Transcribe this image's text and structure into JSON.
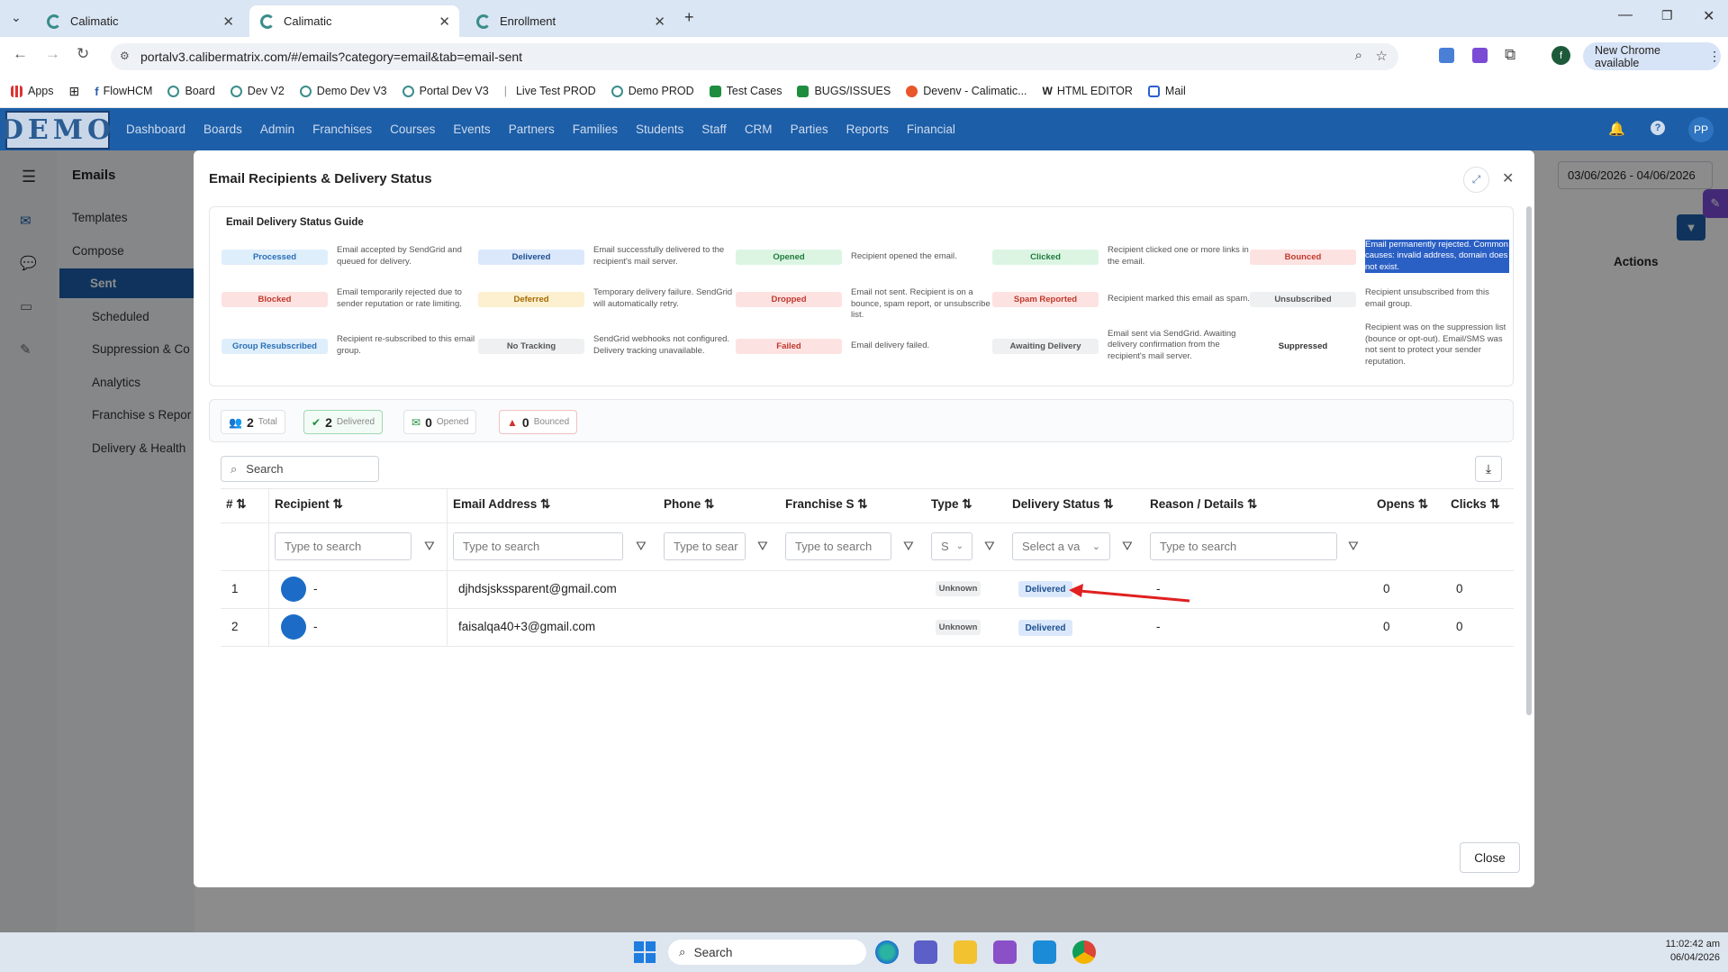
{
  "browser": {
    "tabs": [
      {
        "title": "Calimatic"
      },
      {
        "title": "Calimatic"
      },
      {
        "title": "Enrollment"
      }
    ],
    "url": "portalv3.calibermatrix.com/#/emails?category=email&tab=email-sent",
    "profile_initial": "f",
    "update_label": "New Chrome available",
    "bookmarks": [
      "Apps",
      "FlowHCM",
      "Board",
      "Dev V2",
      "Demo Dev V3",
      "Portal Dev V3",
      "Live Test PROD",
      "Demo PROD",
      "Test Cases",
      "BUGS/ISSUES",
      "Devenv - Calimatic...",
      "HTML EDITOR",
      "Mail"
    ]
  },
  "app": {
    "logo": "DEMO",
    "nav": [
      "Dashboard",
      "Boards",
      "Admin",
      "Franchises",
      "Courses",
      "Events",
      "Partners",
      "Families",
      "Students",
      "Staff",
      "CRM",
      "Parties",
      "Reports",
      "Financial"
    ],
    "user_initials": "PP",
    "section_title": "Emails",
    "sidebar": [
      "Templates",
      "Compose",
      "Sent",
      "Scheduled",
      "Suppression & Co",
      "Analytics",
      "Franchise s Repor",
      "Delivery & Health"
    ],
    "date_range": "03/06/2026 - 04/06/2026",
    "bg_actions_header": "Actions"
  },
  "modal": {
    "title": "Email Recipients & Delivery Status",
    "guide_title": "Email Delivery Status Guide",
    "guide": [
      {
        "status": "Processed",
        "desc": "Email accepted by SendGrid and queued for delivery.",
        "bg": "#dfeefb",
        "fg": "#2a6fb5"
      },
      {
        "status": "Delivered",
        "desc": "Email successfully delivered to the recipient's mail server.",
        "bg": "#dbe8fb",
        "fg": "#1d4f91"
      },
      {
        "status": "Opened",
        "desc": "Recipient opened the email.",
        "bg": "#dcf5e3",
        "fg": "#1e7a3c"
      },
      {
        "status": "Clicked",
        "desc": "Recipient clicked one or more links in the email.",
        "bg": "#dcf5e3",
        "fg": "#1e7a3c"
      },
      {
        "status": "Bounced",
        "desc": "Email permanently rejected. Common causes: invalid address, domain does not exist.",
        "bg": "#fde2e2",
        "fg": "#c0392b"
      },
      {
        "status": "Blocked",
        "desc": "Email temporarily rejected due to sender reputation or rate limiting.",
        "bg": "#fde2e2",
        "fg": "#c0392b"
      },
      {
        "status": "Deferred",
        "desc": "Temporary delivery failure. SendGrid will automatically retry.",
        "bg": "#fdf0d0",
        "fg": "#a66a00"
      },
      {
        "status": "Dropped",
        "desc": "Email not sent. Recipient is on a bounce, spam report, or unsubscribe list.",
        "bg": "#fde2e2",
        "fg": "#c0392b"
      },
      {
        "status": "Spam Reported",
        "desc": "Recipient marked this email as spam.",
        "bg": "#fde2e2",
        "fg": "#c0392b"
      },
      {
        "status": "Unsubscribed",
        "desc": "Recipient unsubscribed from this email group.",
        "bg": "#eef0f2",
        "fg": "#555555"
      },
      {
        "status": "Group Resubscribed",
        "desc": "Recipient re-subscribed to this email group.",
        "bg": "#dfeefb",
        "fg": "#2a6fb5"
      },
      {
        "status": "No Tracking",
        "desc": "SendGrid webhooks not configured. Delivery tracking unavailable.",
        "bg": "#eef0f2",
        "fg": "#555555"
      },
      {
        "status": "Failed",
        "desc": "Email delivery failed.",
        "bg": "#fde2e2",
        "fg": "#c0392b"
      },
      {
        "status": "Awaiting Delivery",
        "desc": "Email sent via SendGrid. Awaiting delivery confirmation from the recipient's mail server.",
        "bg": "#eef0f2",
        "fg": "#555555"
      },
      {
        "status": "Suppressed",
        "desc": "Recipient was on the suppression list (bounce or opt-out). Email/SMS was not sent to protect your sender reputation.",
        "bg": "#ffffff",
        "fg": "#333333"
      }
    ],
    "stats": [
      {
        "count": "2",
        "label": "Total"
      },
      {
        "count": "2",
        "label": "Delivered"
      },
      {
        "count": "0",
        "label": "Opened"
      },
      {
        "count": "0",
        "label": "Bounced"
      }
    ],
    "search_placeholder": "Search",
    "columns": [
      "#",
      "Recipient",
      "Email Address",
      "Phone",
      "Franchise S",
      "Type",
      "Delivery Status",
      "Reason / Details",
      "Opens",
      "Clicks"
    ],
    "filters": {
      "recipient": "Type to search",
      "email": "Type to search",
      "phone": "Type to sear",
      "franchise": "Type to search",
      "type": "S",
      "status": "Select a va",
      "reason": "Type to search"
    },
    "rows": [
      {
        "num": "1",
        "recipient": "-",
        "email": "djhdsjskssparent@gmail.com",
        "phone": "",
        "type": "Unknown",
        "status": "Delivered",
        "reason": "-",
        "opens": "0",
        "clicks": "0"
      },
      {
        "num": "2",
        "recipient": "-",
        "email": "faisalqa40+3@gmail.com",
        "phone": "",
        "type": "Unknown",
        "status": "Delivered",
        "reason": "-",
        "opens": "0",
        "clicks": "0"
      }
    ],
    "close_label": "Close"
  },
  "taskbar": {
    "search": "Search",
    "time": "11:02:42 am",
    "date": "06/04/2026"
  }
}
